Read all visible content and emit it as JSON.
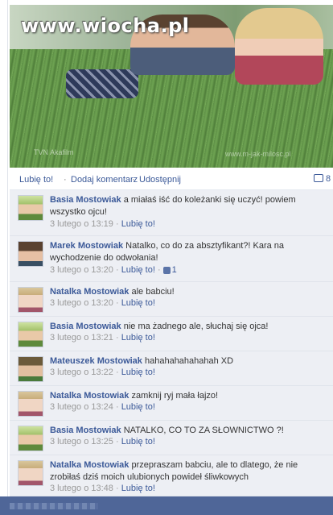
{
  "watermark": {
    "site": "www.wiocha.pl",
    "credit_left": "TVN Akafilm",
    "credit_right": "www.m-jak-milosc.pl"
  },
  "actions": {
    "like": "Lubię to!",
    "dot1": "·",
    "comment": "Dodaj komentarz",
    "dot2": "·",
    "share": "Udostępnij",
    "comment_count": "8"
  },
  "like_label": "Lubię to!",
  "comments": [
    {
      "author": "Basia Mostowiak",
      "text": "a miałaś iść do koleżanki się uczyć! powiem wszystko ojcu!",
      "time": "3 lutego o 13:19",
      "likes": ""
    },
    {
      "author": "Marek Mostowiak",
      "text": "Natalko, co do za absztyfikant?! Kara na wychodzenie do odwołania!",
      "time": "3 lutego o 13:20",
      "likes": "1"
    },
    {
      "author": "Natalka Mostowiak",
      "text": "ale babciu!",
      "time": "3 lutego o 13:20",
      "likes": ""
    },
    {
      "author": "Basia Mostowiak",
      "text": "nie ma żadnego ale, słuchaj się ojca!",
      "time": "3 lutego o 13:21",
      "likes": ""
    },
    {
      "author": "Mateuszek Mostowiak",
      "text": "hahahahahahahah XD",
      "time": "3 lutego o 13:22",
      "likes": ""
    },
    {
      "author": "Natalka Mostowiak",
      "text": "zamknij ryj mała łajzo!",
      "time": "3 lutego o 13:24",
      "likes": ""
    },
    {
      "author": "Basia Mostowiak",
      "text": "NATALKO, CO TO ZA SŁOWNICTWO ?!",
      "time": "3 lutego o 13:25",
      "likes": ""
    },
    {
      "author": "Natalka Mostowiak",
      "text": "przepraszam babciu, ale to dlatego, że nie zrobiłaś dziś moich ulubionych powideł śliwkowych",
      "time": "3 lutego o 13:48",
      "likes": ""
    }
  ],
  "colors": {
    "link": "#3b5998",
    "comment_bg": "#edeff4",
    "footer_bar": "#4f6698"
  }
}
